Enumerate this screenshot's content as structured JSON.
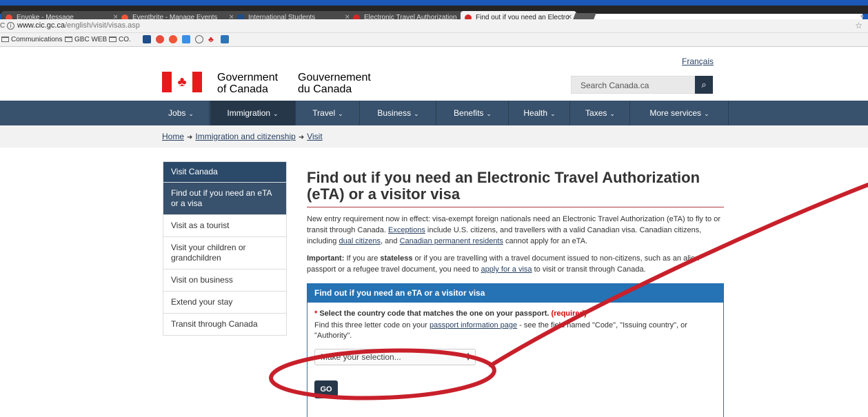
{
  "browser": {
    "tabs": [
      {
        "label": "Envoke - Message",
        "color": "#e74c3c"
      },
      {
        "label": "Eventbrite - Manage Events",
        "color": "#f05537"
      },
      {
        "label": "International Students",
        "color": "#1f4e8a"
      },
      {
        "label": "Electronic Travel Authorization",
        "color": "#d62728"
      },
      {
        "label": "Find out if you need an Electro",
        "color": "#d62728"
      }
    ],
    "url_host": "www.cic.gc.ca",
    "url_path": "/english/visit/visas.asp",
    "bookmarks": [
      "Communications",
      "GBC WEB",
      "CO."
    ]
  },
  "header": {
    "language_link": "Français",
    "gov_en_1": "Government",
    "gov_en_2": "of Canada",
    "gov_fr_1": "Gouvernement",
    "gov_fr_2": "du Canada",
    "search_placeholder": "Search Canada.ca"
  },
  "nav": [
    {
      "label": "Jobs"
    },
    {
      "label": "Immigration"
    },
    {
      "label": "Travel"
    },
    {
      "label": "Business"
    },
    {
      "label": "Benefits"
    },
    {
      "label": "Health"
    },
    {
      "label": "Taxes"
    },
    {
      "label": "More services"
    }
  ],
  "breadcrumb": [
    "Home",
    "Immigration and citizenship",
    "Visit"
  ],
  "sidemenu": [
    "Visit Canada",
    "Find out if you need an eTA or a visa",
    "Visit as a tourist",
    "Visit your children or grandchildren",
    "Visit on business",
    "Extend your stay",
    "Transit through Canada"
  ],
  "main": {
    "title": "Find out if you need an Electronic Travel Authorization (eTA) or a visitor visa",
    "p1_a": "New entry requirement now in effect: visa-exempt foreign nationals need an Electronic Travel Authorization (eTA) to fly to or transit through Canada. ",
    "p1_link1": "Exceptions",
    "p1_b": " include U.S. citizens, and travellers with a valid Canadian visa. Canadian citizens, including ",
    "p1_link2": "dual citizens",
    "p1_c": ", and ",
    "p1_link3": "Canadian permanent residents",
    "p1_d": " cannot apply for an eTA.",
    "p2_strong": "Important:",
    "p2_a": " If you are ",
    "p2_stateless": "stateless",
    "p2_b": " or if you are travelling with a travel document issued to non-citizens, such as an alien passport or a refugee travel document, you need to ",
    "p2_link": "apply for a visa",
    "p2_c": " to visit or transit through Canada."
  },
  "panel": {
    "title": "Find out if you need an eTA or a visitor visa",
    "label": "Select the country code that matches the one on your passport.",
    "required": "(required)",
    "hint_a": "Find this three letter code on your ",
    "hint_link": "passport information page",
    "hint_b": " - see the field named \"Code\", \"Issuing country\", or \"Authority\".",
    "select_value": "Make your selection...",
    "go_label": "GO"
  },
  "colors": {
    "annotation": "#c8202b",
    "frame": "#1b58b8"
  }
}
